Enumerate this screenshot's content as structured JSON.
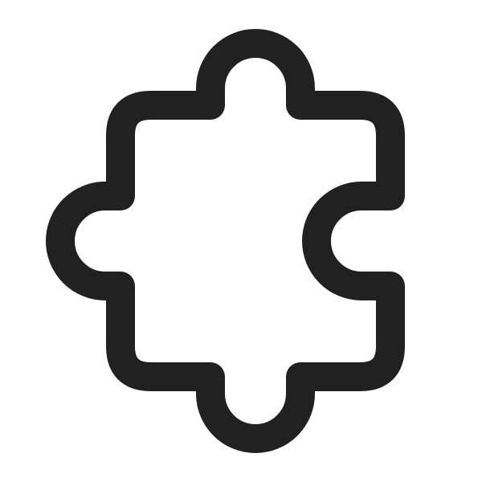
{
  "icon": {
    "name": "puzzle-piece-icon",
    "stroke_color": "#212121",
    "fill_color": "#ffffff",
    "background_color": "#ffffff"
  }
}
